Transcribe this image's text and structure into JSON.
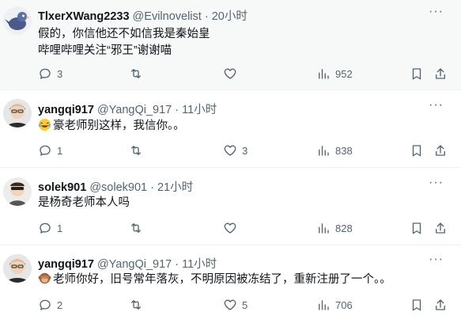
{
  "tweets": [
    {
      "display_name": "TlxerXWang2233",
      "handle": "@Evilnovelist",
      "sep": "·",
      "time": "20小时",
      "lines": [
        "假的，你信他还不如信我是秦始皇",
        "哔哩哔哩关注“邪王”谢谢喵"
      ],
      "replies": "3",
      "retweets": "",
      "likes": "",
      "views": "952"
    },
    {
      "display_name": "yangqi917",
      "handle": "@YangQi_917",
      "sep": "·",
      "time": "11小时",
      "lines": [
        "豪老师别这样，我信你。。"
      ],
      "replies": "1",
      "retweets": "",
      "likes": "3",
      "views": "838"
    },
    {
      "display_name": "solek901",
      "handle": "@solek901",
      "sep": "·",
      "time": "21小时",
      "lines": [
        "是杨奇老师本人吗"
      ],
      "replies": "1",
      "retweets": "",
      "likes": "",
      "views": "828"
    },
    {
      "display_name": "yangqi917",
      "handle": "@YangQi_917",
      "sep": "·",
      "time": "11小时",
      "lines": [
        "老师你好，旧号常年落灰，不明原因被冻结了，重新注册了一个。。"
      ],
      "replies": "2",
      "retweets": "",
      "likes": "5",
      "views": "706"
    }
  ],
  "more_glyph": "···",
  "icons": {
    "reply": "reply-icon",
    "retweet": "retweet-icon",
    "like": "heart-icon",
    "views": "views-icon",
    "bookmark": "bookmark-icon",
    "share": "share-icon",
    "more": "more-icon",
    "tears_of_joy": "tears-of-joy-emoji",
    "see_no_evil": "see-no-evil-monkey-emoji"
  },
  "colors": {
    "text": "#0f1419",
    "secondary": "#536471",
    "highlight_bg": "#f7f9f9",
    "divider": "#eff3f4"
  }
}
